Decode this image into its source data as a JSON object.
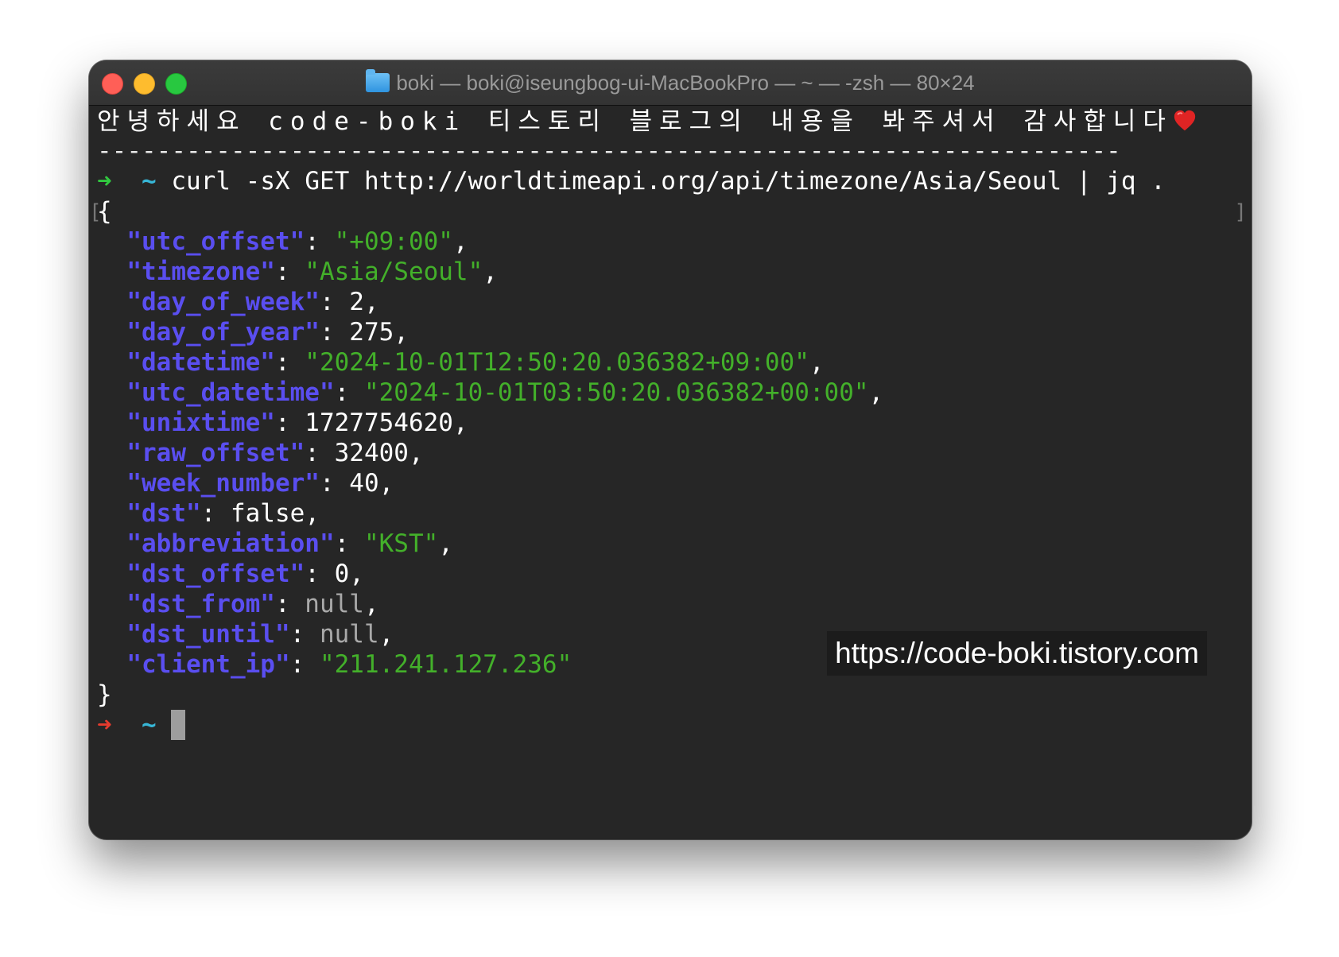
{
  "window": {
    "title": "boki — boki@iseungbog-ui-MacBookPro — ~ — -zsh — 80×24",
    "title_icon": "folder-icon"
  },
  "terminal": {
    "greeting": "안녕하세요 code-boki 티스토리 블로그의 내용을 봐주셔서 감사합니다",
    "greeting_icon": "heart-icon",
    "divider": "---------------------------------------------------------------------",
    "prompt_arrow": "➜",
    "prompt_dir": "~",
    "command": "curl -sX GET http://worldtimeapi.org/api/timezone/Asia/Seoul | jq .",
    "open_brace": "{",
    "close_brace": "}",
    "json": [
      {
        "key": "\"utc_offset\"",
        "value": "\"+09:00\"",
        "type": "str",
        "comma": ","
      },
      {
        "key": "\"timezone\"",
        "value": "\"Asia/Seoul\"",
        "type": "str",
        "comma": ","
      },
      {
        "key": "\"day_of_week\"",
        "value": "2",
        "type": "num",
        "comma": ","
      },
      {
        "key": "\"day_of_year\"",
        "value": "275",
        "type": "num",
        "comma": ","
      },
      {
        "key": "\"datetime\"",
        "value": "\"2024-10-01T12:50:20.036382+09:00\"",
        "type": "str",
        "comma": ","
      },
      {
        "key": "\"utc_datetime\"",
        "value": "\"2024-10-01T03:50:20.036382+00:00\"",
        "type": "str",
        "comma": ","
      },
      {
        "key": "\"unixtime\"",
        "value": "1727754620",
        "type": "num",
        "comma": ","
      },
      {
        "key": "\"raw_offset\"",
        "value": "32400",
        "type": "num",
        "comma": ","
      },
      {
        "key": "\"week_number\"",
        "value": "40",
        "type": "num",
        "comma": ","
      },
      {
        "key": "\"dst\"",
        "value": "false",
        "type": "num",
        "comma": ","
      },
      {
        "key": "\"abbreviation\"",
        "value": "\"KST\"",
        "type": "str",
        "comma": ","
      },
      {
        "key": "\"dst_offset\"",
        "value": "0",
        "type": "num",
        "comma": ","
      },
      {
        "key": "\"dst_from\"",
        "value": "null",
        "type": "nul",
        "comma": ","
      },
      {
        "key": "\"dst_until\"",
        "value": "null",
        "type": "nul",
        "comma": ","
      },
      {
        "key": "\"client_ip\"",
        "value": "\"211.241.127.236\"",
        "type": "str",
        "comma": ""
      }
    ],
    "final_prompt_arrow": "➜",
    "final_prompt_dir": "~"
  },
  "watermark": {
    "text": "https://code-boki.tistory.com"
  },
  "colors": {
    "json_key": "#5a4ef0",
    "json_string": "#43b02a",
    "prompt_green": "#31c940",
    "prompt_red": "#e53b2e",
    "prompt_dir": "#37b6d6",
    "background": "#262626"
  }
}
